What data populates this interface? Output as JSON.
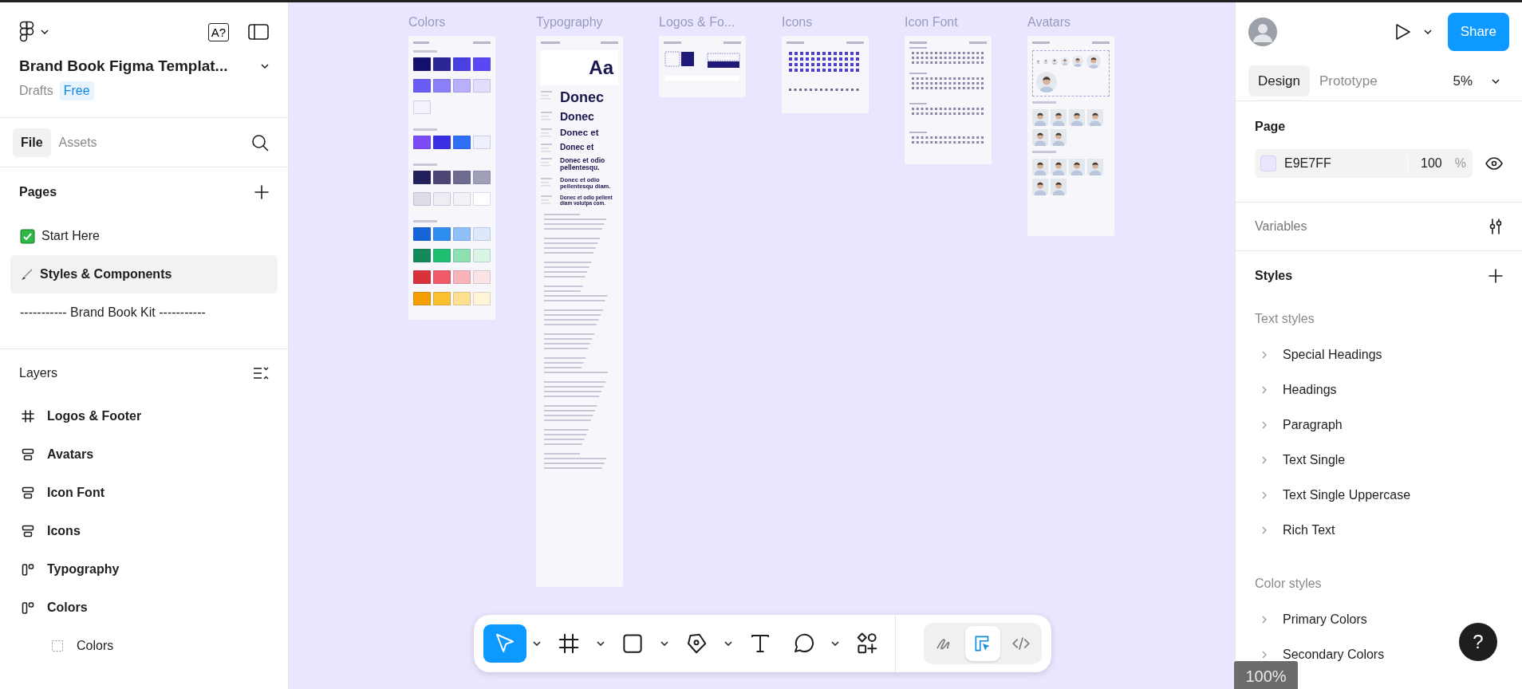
{
  "header": {
    "title": "Brand Book Figma Templat...",
    "location": "Drafts",
    "plan": "Free",
    "font_button": "A?"
  },
  "left_tabs": [
    {
      "label": "File",
      "selected": true
    },
    {
      "label": "Assets",
      "selected": false
    }
  ],
  "pages": {
    "title": "Pages",
    "items": [
      {
        "kind": "check",
        "label": "Start Here",
        "selected": false
      },
      {
        "kind": "brush",
        "label": "Styles & Components",
        "selected": true
      },
      {
        "kind": "plain",
        "label": "----------- Brand Book Kit -----------",
        "selected": false
      }
    ]
  },
  "layers": {
    "title": "Layers",
    "items": [
      {
        "kind": "frame",
        "label": "Logos & Footer"
      },
      {
        "kind": "stack",
        "label": "Avatars"
      },
      {
        "kind": "stack",
        "label": "Icon Font"
      },
      {
        "kind": "stack",
        "label": "Icons"
      },
      {
        "kind": "columns",
        "label": "Typography"
      },
      {
        "kind": "columns",
        "label": "Colors",
        "children": [
          {
            "kind": "group",
            "label": "Colors"
          }
        ]
      }
    ]
  },
  "canvas": {
    "frames": [
      {
        "title": "Colors",
        "kind": "colors",
        "groups": [
          {
            "swatches": [
              {
                "color": "#14106b"
              },
              {
                "color": "#2b2596"
              },
              {
                "color": "#4a3fe0"
              },
              {
                "color": "#5a48f5"
              },
              {
                "color": "#6a5cf5"
              },
              {
                "color": "#8c80f8"
              },
              {
                "color": "#b8b0fb"
              },
              {
                "color": "#e1ddfc"
              },
              {
                "color": "#f3f2fd"
              }
            ]
          },
          {
            "swatches": [
              {
                "color": "#7b4cf5"
              },
              {
                "color": "#3a2fe0"
              },
              {
                "color": "#2f6ff5"
              },
              {
                "color": "#eef0fd"
              }
            ]
          },
          {
            "swatches": [
              {
                "color": "#22205a"
              },
              {
                "color": "#4d4675"
              },
              {
                "color": "#6f6d8f"
              },
              {
                "color": "#a09fb8"
              },
              {
                "color": "#dcdde6"
              },
              {
                "color": "#eceef3"
              },
              {
                "color": "#f3f3f7"
              },
              {
                "color": "#ffffff"
              }
            ]
          },
          {
            "swatches": [
              {
                "color": "#1565d8"
              },
              {
                "color": "#2e8ef0"
              },
              {
                "color": "#90c0f5"
              },
              {
                "color": "#dce9fb"
              },
              {
                "color": "#148a5a"
              },
              {
                "color": "#1fbf6f"
              },
              {
                "color": "#8ee0b0"
              },
              {
                "color": "#d8f5e4"
              },
              {
                "color": "#d8323a"
              },
              {
                "color": "#f05a66"
              },
              {
                "color": "#f8b4b8"
              },
              {
                "color": "#fde4e4"
              },
              {
                "color": "#f5a000"
              },
              {
                "color": "#fbc02d"
              },
              {
                "color": "#fde090"
              },
              {
                "color": "#fff4d6"
              }
            ]
          }
        ]
      },
      {
        "title": "Typography",
        "kind": "typography",
        "sample": "Aa",
        "specimens": [
          "Donec",
          "Donec",
          "Donec et",
          "Donec et",
          "Donec et odio pellentesqu.",
          "Donec et odio pellentesqu diam.",
          "Donec et odio pellent diam volutpa com."
        ]
      },
      {
        "title": "Logos & Fo...",
        "kind": "logos"
      },
      {
        "title": "Icons",
        "kind": "icons"
      },
      {
        "title": "Icon Font",
        "kind": "icon_font"
      },
      {
        "title": "Avatars",
        "kind": "avatars"
      }
    ]
  },
  "toolbar": {
    "tools": [
      {
        "kind": "move",
        "selected": true,
        "menu": true
      },
      {
        "kind": "frame",
        "selected": false,
        "menu": true
      },
      {
        "kind": "rectangle",
        "selected": false,
        "menu": true
      },
      {
        "kind": "pen",
        "selected": false,
        "menu": true
      },
      {
        "kind": "text",
        "selected": false,
        "menu": false
      },
      {
        "kind": "comment",
        "selected": false,
        "menu": true
      },
      {
        "kind": "components",
        "selected": false,
        "menu": false
      }
    ],
    "modes": [
      {
        "kind": "draw",
        "selected": false
      },
      {
        "kind": "design",
        "selected": true
      },
      {
        "kind": "dev",
        "selected": false
      }
    ]
  },
  "share": "Share",
  "right_tabs": [
    {
      "label": "Design",
      "selected": true
    },
    {
      "label": "Prototype",
      "selected": false
    }
  ],
  "zoom": "5%",
  "page": {
    "title": "Page",
    "color": "#e9e7ff",
    "hex": "E9E7FF",
    "opacity": "100",
    "unit": "%"
  },
  "variables": "Variables",
  "styles": {
    "title": "Styles",
    "groups": [
      {
        "title": "Text styles",
        "items": [
          "Special Headings",
          "Headings",
          "Paragraph",
          "Text Single",
          "Text Single Uppercase",
          "Rich Text"
        ]
      },
      {
        "title": "Color styles",
        "items": [
          "Primary Colors",
          "Secondary Colors"
        ]
      }
    ]
  },
  "help": "?",
  "zoom_badge": "100%"
}
